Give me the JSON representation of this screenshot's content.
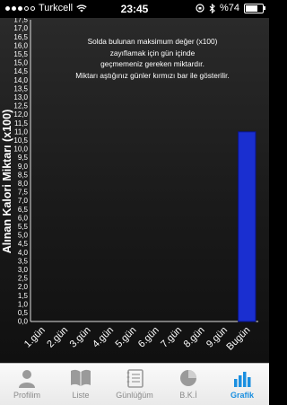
{
  "status": {
    "carrier": "Turkcell",
    "time": "23:45",
    "battery": "%74",
    "battery_level": 0.74
  },
  "chart": {
    "ylabel": "Alınan Kalori Miktarı (x100)",
    "note": [
      "Solda bulunan maksimum değer (x100)",
      "zayıflamak için gün içinde",
      "geçmemeniz gereken miktardır.",
      "Miktarı aştığınız günler kırmızı bar ile gösterilir."
    ]
  },
  "chart_data": {
    "type": "bar",
    "categories": [
      "1.gün",
      "2.gün",
      "3.gün",
      "4.gün",
      "5.gün",
      "6.gün",
      "7.gün",
      "8.gün",
      "9.gün",
      "Bugün"
    ],
    "values": [
      0,
      0,
      0,
      0,
      0,
      0,
      0,
      0,
      0,
      11.0
    ],
    "ylabel": "Alınan Kalori Miktarı (x100)",
    "ylim": [
      0,
      17.5
    ],
    "ytick_step": 0.5,
    "ytick_labels": [
      "0,0",
      "0,5",
      "1,0",
      "1,5",
      "2,0",
      "2,5",
      "3,0",
      "3,5",
      "4,0",
      "4,5",
      "5,0",
      "5,5",
      "6,0",
      "6,5",
      "7,0",
      "7,5",
      "8,0",
      "8,5",
      "9,0",
      "9,5",
      "10,0",
      "10,5",
      "11,0",
      "11,5",
      "12,0",
      "12,5",
      "13,0",
      "13,5",
      "14,0",
      "14,5",
      "15,0",
      "15,5",
      "16,0",
      "16,5",
      "17,0",
      "17,5"
    ],
    "bar_color": "#1a2fd0",
    "grid": false,
    "legend": "none"
  },
  "tabs": [
    {
      "label": "Profilim",
      "icon": "person-icon",
      "active": false
    },
    {
      "label": "Liste",
      "icon": "book-icon",
      "active": false
    },
    {
      "label": "Günlüğüm",
      "icon": "notebook-icon",
      "active": false
    },
    {
      "label": "B.K.İ",
      "icon": "pie-chart-icon",
      "active": false
    },
    {
      "label": "Grafik",
      "icon": "bar-chart-icon",
      "active": true
    }
  ],
  "colors": {
    "accent": "#1a8fe0",
    "inactive": "#8a8a8a",
    "bar": "#1a2fd0"
  }
}
